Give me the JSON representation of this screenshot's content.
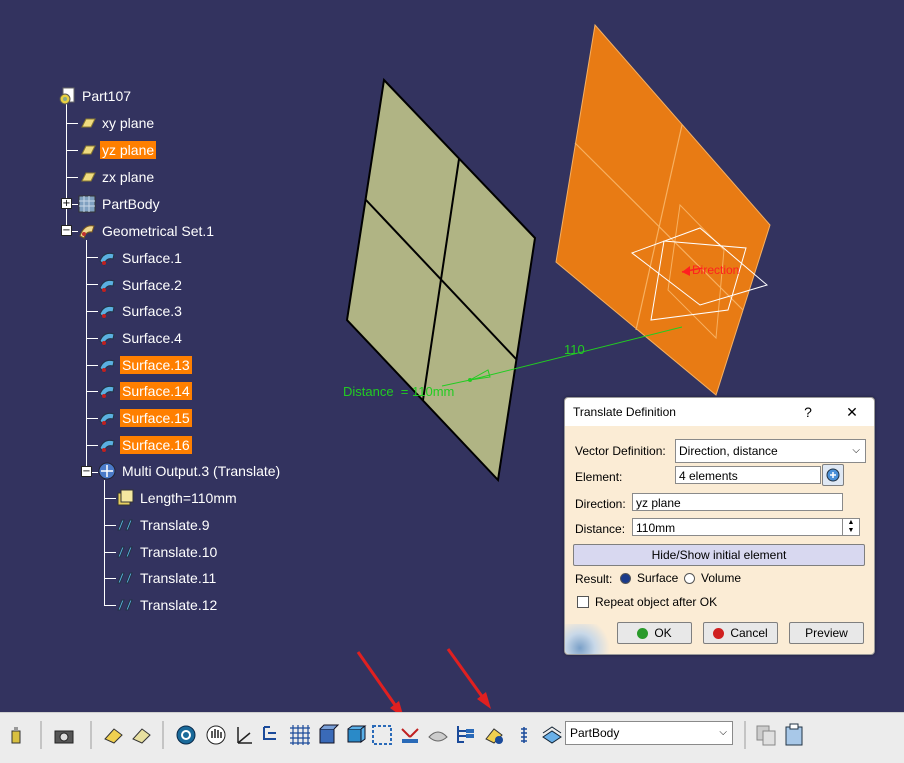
{
  "tree": {
    "root": "Part107",
    "planes": [
      "xy plane",
      "yz plane",
      "zx plane"
    ],
    "body": "PartBody",
    "geoset": "Geometrical Set.1",
    "surfaces": [
      "Surface.1",
      "Surface.2",
      "Surface.3",
      "Surface.4",
      "Surface.13",
      "Surface.14",
      "Surface.15",
      "Surface.16"
    ],
    "multi_output": "Multi Output.3 (Translate)",
    "length": "Length=110mm",
    "translates": [
      "Translate.9",
      "Translate.10",
      "Translate.11",
      "Translate.12"
    ]
  },
  "viewport": {
    "dim_value": "110",
    "distance_label": "Distance  = 110mm",
    "direction_label": "Direction",
    "colors": {
      "surface": "#b0b484",
      "preview": "#e87b14",
      "dimension": "#22cc22",
      "direction": "#ff2020"
    }
  },
  "dialog": {
    "title": "Translate Definition",
    "help": "?",
    "close": "✕",
    "vector_label": "Vector Definition:",
    "vector_value": "Direction, distance",
    "element_label": "Element:",
    "element_value": "4 elements",
    "direction_label": "Direction:",
    "direction_value": "yz plane",
    "distance_label": "Distance:",
    "distance_value": "110mm",
    "hide_show": "Hide/Show initial element",
    "result_label": "Result:",
    "result_surface": "Surface",
    "result_volume": "Volume",
    "repeat_label": "Repeat object after OK",
    "ok": "OK",
    "cancel": "Cancel",
    "preview": "Preview"
  },
  "toolbar": {
    "body_select": "PartBody"
  }
}
